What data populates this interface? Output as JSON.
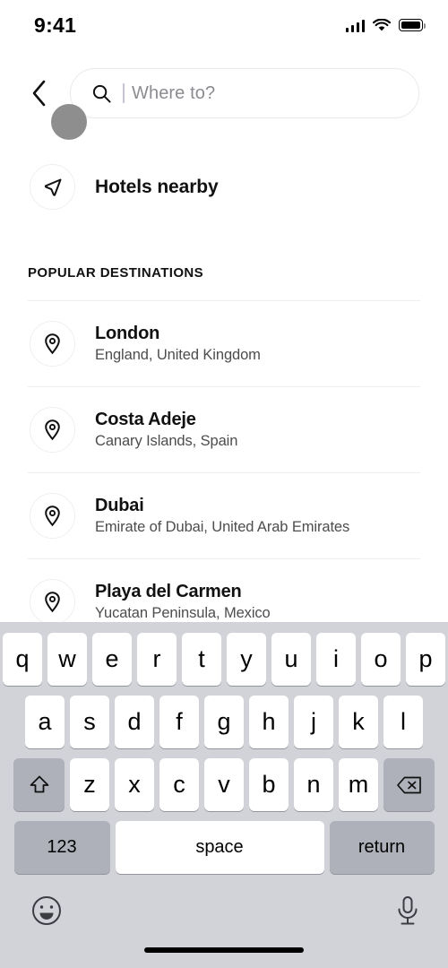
{
  "status_bar": {
    "time": "9:41",
    "cellular_icon": "cellular-bars-icon",
    "wifi_icon": "wifi-icon",
    "battery_icon": "battery-full-icon"
  },
  "header": {
    "back_icon": "chevron-left-icon",
    "search": {
      "icon": "search-icon",
      "placeholder": "Where to?",
      "value": ""
    }
  },
  "nearby": {
    "icon": "navigation-arrow-icon",
    "label": "Hotels nearby"
  },
  "section": {
    "title": "POPULAR DESTINATIONS"
  },
  "destinations": [
    {
      "icon": "map-pin-icon",
      "name": "London",
      "subtitle": "England, United Kingdom"
    },
    {
      "icon": "map-pin-icon",
      "name": "Costa Adeje",
      "subtitle": "Canary Islands, Spain"
    },
    {
      "icon": "map-pin-icon",
      "name": "Dubai",
      "subtitle": "Emirate of Dubai, United Arab Emirates"
    },
    {
      "icon": "map-pin-icon",
      "name": "Playa del Carmen",
      "subtitle": "Yucatan Peninsula, Mexico"
    }
  ],
  "keyboard": {
    "row1": [
      "q",
      "w",
      "e",
      "r",
      "t",
      "y",
      "u",
      "i",
      "o",
      "p"
    ],
    "row2": [
      "a",
      "s",
      "d",
      "f",
      "g",
      "h",
      "j",
      "k",
      "l"
    ],
    "row3": [
      "z",
      "x",
      "c",
      "v",
      "b",
      "n",
      "m"
    ],
    "shift_icon": "shift-arrow-icon",
    "backspace_icon": "backspace-delete-icon",
    "numbers_label": "123",
    "space_label": "space",
    "return_label": "return",
    "emoji_icon": "emoji-smiley-icon",
    "dictation_icon": "microphone-icon"
  },
  "colors": {
    "keyboard_background": "#d1d3d9",
    "key_face": "#ffffff",
    "modifier_key": "#aeb1b9",
    "text_primary": "#111111",
    "text_secondary": "#4d4d4f",
    "placeholder": "#8b8b90",
    "separator": "#eeeeee",
    "touch_indicator": "#8e8e8e"
  }
}
